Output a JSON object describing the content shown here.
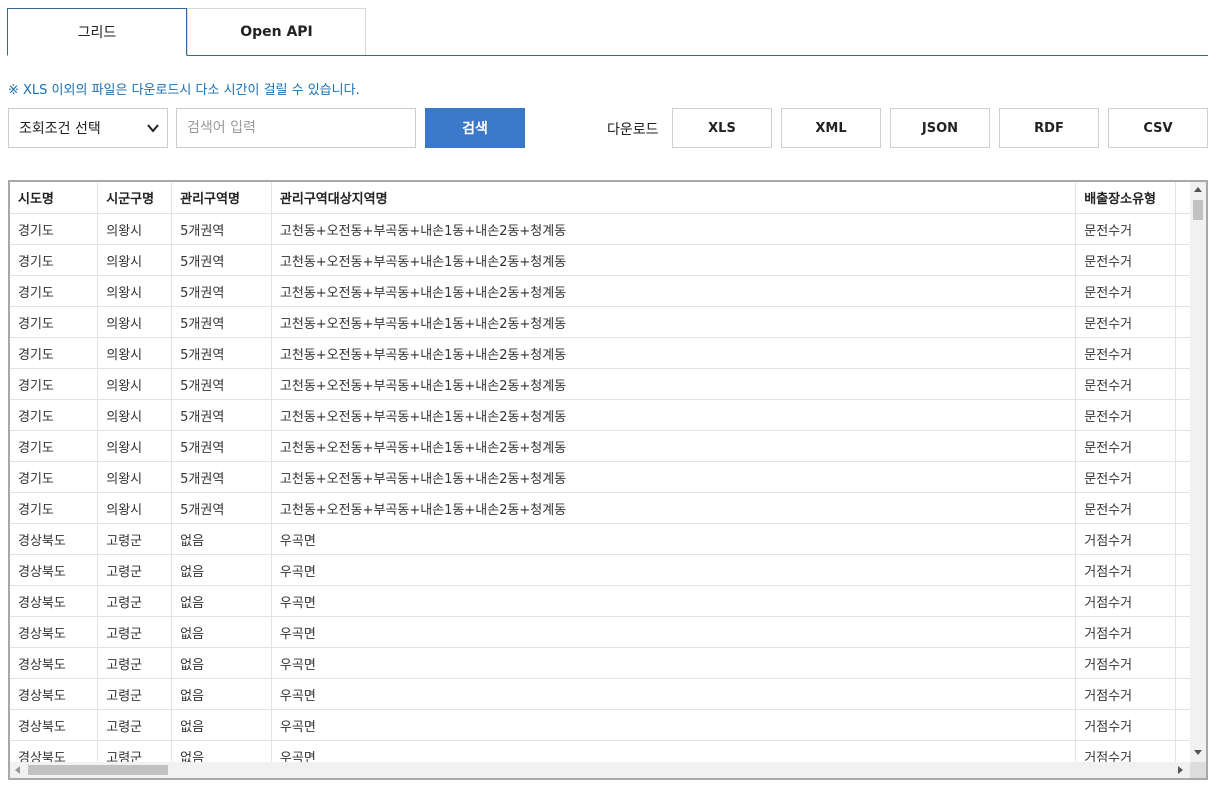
{
  "tabs": [
    {
      "label": "그리드",
      "active": true
    },
    {
      "label": "Open API",
      "active": false
    }
  ],
  "notice": "※ XLS 이외의 파일은 다운로드시 다소 시간이 걸릴 수 있습니다.",
  "search": {
    "select_value": "조회조건 선택",
    "placeholder": "검색어 입력",
    "button_label": "검색"
  },
  "download": {
    "label": "다운로드",
    "formats": [
      "XLS",
      "XML",
      "JSON",
      "RDF",
      "CSV"
    ]
  },
  "grid": {
    "columns": [
      "시도명",
      "시군구명",
      "관리구역명",
      "관리구역대상지역명",
      "배출장소유형",
      ""
    ],
    "rows": [
      [
        "경기도",
        "의왕시",
        "5개권역",
        "고천동+오전동+부곡동+내손1동+내손2동+청계동",
        "문전수거",
        ""
      ],
      [
        "경기도",
        "의왕시",
        "5개권역",
        "고천동+오전동+부곡동+내손1동+내손2동+청계동",
        "문전수거",
        ""
      ],
      [
        "경기도",
        "의왕시",
        "5개권역",
        "고천동+오전동+부곡동+내손1동+내손2동+청계동",
        "문전수거",
        ""
      ],
      [
        "경기도",
        "의왕시",
        "5개권역",
        "고천동+오전동+부곡동+내손1동+내손2동+청계동",
        "문전수거",
        ""
      ],
      [
        "경기도",
        "의왕시",
        "5개권역",
        "고천동+오전동+부곡동+내손1동+내손2동+청계동",
        "문전수거",
        ""
      ],
      [
        "경기도",
        "의왕시",
        "5개권역",
        "고천동+오전동+부곡동+내손1동+내손2동+청계동",
        "문전수거",
        ""
      ],
      [
        "경기도",
        "의왕시",
        "5개권역",
        "고천동+오전동+부곡동+내손1동+내손2동+청계동",
        "문전수거",
        ""
      ],
      [
        "경기도",
        "의왕시",
        "5개권역",
        "고천동+오전동+부곡동+내손1동+내손2동+청계동",
        "문전수거",
        ""
      ],
      [
        "경기도",
        "의왕시",
        "5개권역",
        "고천동+오전동+부곡동+내손1동+내손2동+청계동",
        "문전수거",
        ""
      ],
      [
        "경기도",
        "의왕시",
        "5개권역",
        "고천동+오전동+부곡동+내손1동+내손2동+청계동",
        "문전수거",
        ""
      ],
      [
        "경상북도",
        "고령군",
        "없음",
        "우곡면",
        "거점수거",
        ""
      ],
      [
        "경상북도",
        "고령군",
        "없음",
        "우곡면",
        "거점수거",
        ""
      ],
      [
        "경상북도",
        "고령군",
        "없음",
        "우곡면",
        "거점수거",
        ""
      ],
      [
        "경상북도",
        "고령군",
        "없음",
        "우곡면",
        "거점수거",
        ""
      ],
      [
        "경상북도",
        "고령군",
        "없음",
        "우곡면",
        "거점수거",
        ""
      ],
      [
        "경상북도",
        "고령군",
        "없음",
        "우곡면",
        "거점수거",
        ""
      ],
      [
        "경상북도",
        "고령군",
        "없음",
        "우곡면",
        "거점수거",
        ""
      ],
      [
        "경상북도",
        "고령군",
        "없음",
        "우곡면",
        "거점수거",
        ""
      ]
    ]
  }
}
